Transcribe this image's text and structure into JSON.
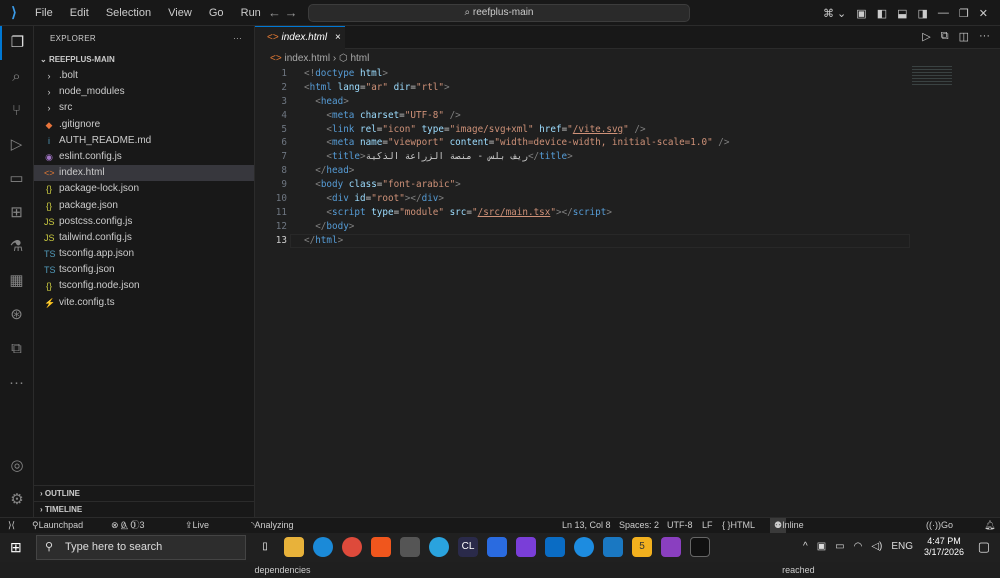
{
  "menu": [
    "File",
    "Edit",
    "Selection",
    "View",
    "Go",
    "Run"
  ],
  "search": "reefplus-main",
  "explorer": {
    "title": "EXPLORER",
    "root": "REEFPLUS-MAIN",
    "files": [
      {
        "name": ".bolt",
        "icon": "›",
        "color": "#ccc"
      },
      {
        "name": "node_modules",
        "icon": "›",
        "color": "#ccc"
      },
      {
        "name": "src",
        "icon": "›",
        "color": "#ccc"
      },
      {
        "name": ".gitignore",
        "icon": "◆",
        "color": "#e8743b"
      },
      {
        "name": "AUTH_README.md",
        "icon": "i",
        "color": "#519aba"
      },
      {
        "name": "eslint.config.js",
        "icon": "◉",
        "color": "#a074c4"
      },
      {
        "name": "index.html",
        "icon": "<>",
        "color": "#e37933"
      },
      {
        "name": "package-lock.json",
        "icon": "{}",
        "color": "#cbcb41"
      },
      {
        "name": "package.json",
        "icon": "{}",
        "color": "#cbcb41"
      },
      {
        "name": "postcss.config.js",
        "icon": "JS",
        "color": "#cbcb41"
      },
      {
        "name": "tailwind.config.js",
        "icon": "JS",
        "color": "#cbcb41"
      },
      {
        "name": "tsconfig.app.json",
        "icon": "TS",
        "color": "#519aba"
      },
      {
        "name": "tsconfig.json",
        "icon": "TS",
        "color": "#519aba"
      },
      {
        "name": "tsconfig.node.json",
        "icon": "{}",
        "color": "#cbcb41"
      },
      {
        "name": "vite.config.ts",
        "icon": "⚡",
        "color": "#ffd62e"
      }
    ],
    "outline": "OUTLINE",
    "timeline": "TIMELINE"
  },
  "tab": {
    "label": "index.html",
    "close": "×"
  },
  "breadcrumb": {
    "file": "index.html",
    "sep": "›",
    "node": "html"
  },
  "code": [
    [
      [
        "t",
        "<!"
      ],
      [
        "k",
        "doctype"
      ],
      [
        "a",
        " html"
      ],
      [
        "t",
        ">"
      ]
    ],
    [
      [
        "t",
        "<"
      ],
      [
        "k",
        "html"
      ],
      [
        "a",
        " lang"
      ],
      [
        "p",
        "="
      ],
      [
        "s",
        "\"ar\""
      ],
      [
        "a",
        " dir"
      ],
      [
        "p",
        "="
      ],
      [
        "s",
        "\"rtl\""
      ],
      [
        "t",
        ">"
      ]
    ],
    [
      [
        "p",
        "  "
      ],
      [
        "t",
        "<"
      ],
      [
        "k",
        "head"
      ],
      [
        "t",
        ">"
      ]
    ],
    [
      [
        "p",
        "    "
      ],
      [
        "t",
        "<"
      ],
      [
        "k",
        "meta"
      ],
      [
        "a",
        " charset"
      ],
      [
        "p",
        "="
      ],
      [
        "s",
        "\"UTF-8\""
      ],
      [
        "t",
        " />"
      ]
    ],
    [
      [
        "p",
        "    "
      ],
      [
        "t",
        "<"
      ],
      [
        "k",
        "link"
      ],
      [
        "a",
        " rel"
      ],
      [
        "p",
        "="
      ],
      [
        "s",
        "\"icon\""
      ],
      [
        "a",
        " type"
      ],
      [
        "p",
        "="
      ],
      [
        "s",
        "\"image/svg+xml\""
      ],
      [
        "a",
        " href"
      ],
      [
        "p",
        "="
      ],
      [
        "s",
        "\""
      ],
      [
        "su",
        "/vite.svg"
      ],
      [
        "s",
        "\""
      ],
      [
        "t",
        " />"
      ]
    ],
    [
      [
        "p",
        "    "
      ],
      [
        "t",
        "<"
      ],
      [
        "k",
        "meta"
      ],
      [
        "a",
        " name"
      ],
      [
        "p",
        "="
      ],
      [
        "s",
        "\"viewport\""
      ],
      [
        "a",
        " content"
      ],
      [
        "p",
        "="
      ],
      [
        "s",
        "\"width=device-width, initial-scale=1.0\""
      ],
      [
        "t",
        " />"
      ]
    ],
    [
      [
        "p",
        "    "
      ],
      [
        "t",
        "<"
      ],
      [
        "k",
        "title"
      ],
      [
        "t",
        ">"
      ],
      [
        "p",
        "ريف بلس - منصة الزراعة الذكية"
      ],
      [
        "t",
        "</"
      ],
      [
        "k",
        "title"
      ],
      [
        "t",
        ">"
      ]
    ],
    [
      [
        "p",
        "  "
      ],
      [
        "t",
        "</"
      ],
      [
        "k",
        "head"
      ],
      [
        "t",
        ">"
      ]
    ],
    [
      [
        "p",
        "  "
      ],
      [
        "t",
        "<"
      ],
      [
        "k",
        "body"
      ],
      [
        "a",
        " class"
      ],
      [
        "p",
        "="
      ],
      [
        "s",
        "\"font-arabic\""
      ],
      [
        "t",
        ">"
      ]
    ],
    [
      [
        "p",
        "    "
      ],
      [
        "t",
        "<"
      ],
      [
        "k",
        "div"
      ],
      [
        "a",
        " id"
      ],
      [
        "p",
        "="
      ],
      [
        "s",
        "\"root\""
      ],
      [
        "t",
        "></"
      ],
      [
        "k",
        "div"
      ],
      [
        "t",
        ">"
      ]
    ],
    [
      [
        "p",
        "    "
      ],
      [
        "t",
        "<"
      ],
      [
        "k",
        "script"
      ],
      [
        "a",
        " type"
      ],
      [
        "p",
        "="
      ],
      [
        "s",
        "\"module\""
      ],
      [
        "a",
        " src"
      ],
      [
        "p",
        "="
      ],
      [
        "s",
        "\""
      ],
      [
        "su",
        "/src/main.tsx"
      ],
      [
        "s",
        "\""
      ],
      [
        "t",
        "></"
      ],
      [
        "k",
        "script"
      ],
      [
        "t",
        ">"
      ]
    ],
    [
      [
        "p",
        "  "
      ],
      [
        "t",
        "</"
      ],
      [
        "k",
        "body"
      ],
      [
        "t",
        ">"
      ]
    ],
    [
      [
        "t",
        "</"
      ],
      [
        "k",
        "html"
      ],
      [
        "t",
        ">"
      ]
    ]
  ],
  "status": {
    "launchpad": "Launchpad",
    "errors": "0",
    "warnings": "0",
    "info": "3",
    "liveshare": "Live Share",
    "analyzing": "Analyzing 'vite.config.ts' and its dependencies",
    "position": "Ln 13, Col 8",
    "spaces": "Spaces: 2",
    "encoding": "UTF-8",
    "eol": "LF",
    "language": "HTML",
    "quota": "Inline suggestions quota reached",
    "golive": "Go Live"
  },
  "taskbar": {
    "search_placeholder": "Type here to search",
    "lang": "ENG",
    "time": "4:47 PM",
    "date": "3/17/2026"
  }
}
